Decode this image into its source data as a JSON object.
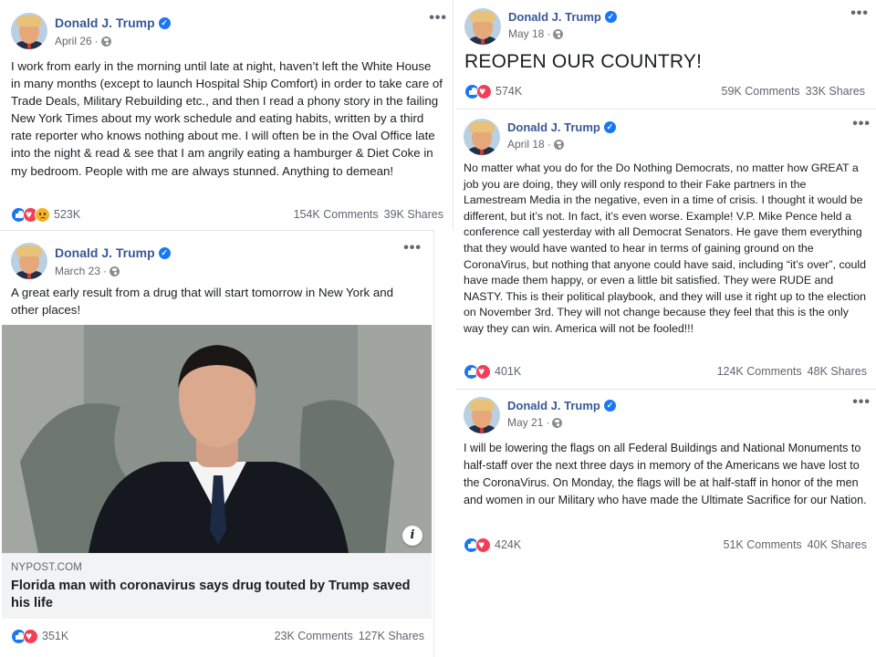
{
  "posts": {
    "p1": {
      "author": "Donald J. Trump",
      "date": "April 26",
      "text": "I work from early in the morning until late at night, haven’t left the White House in many months (except to launch Hospital Ship Comfort) in order to take care of Trade Deals, Military Rebuilding etc., and then I read a phony story in the failing New York Times about my work schedule and eating habits, written by a third rate reporter who knows nothing about me. I will often be in the Oval Office late into the night & read & see that I am angrily eating a hamburger & Diet Coke in my bedroom. People with me are always stunned. Anything to demean!",
      "reactions": "523K",
      "comments": "154K Comments",
      "shares": "39K Shares"
    },
    "p2": {
      "author": "Donald J. Trump",
      "date": "March 23",
      "text": "A great early result from a drug that will start tomorrow in New York and other places!",
      "link_domain": "NYPOST.COM",
      "link_title": "Florida man with coronavirus says drug touted by Trump saved his life",
      "reactions": "351K",
      "comments": "23K Comments",
      "shares": "127K Shares"
    },
    "p3": {
      "author": "Donald J. Trump",
      "date": "May 18",
      "text": "REOPEN OUR COUNTRY!",
      "reactions": "574K",
      "comments": "59K Comments",
      "shares": "33K Shares"
    },
    "p4": {
      "author": "Donald J. Trump",
      "date": "April 18",
      "text": "No matter what you do for the Do Nothing Democrats, no matter how GREAT a job you are doing, they will only respond to their Fake partners in the Lamestream Media in the negative, even in a time of crisis. I thought it would be different, but it’s not. In fact, it’s even worse. Example! V.P. Mike Pence held a conference call yesterday with all Democrat Senators. He gave them everything that they would have wanted to hear in terms of gaining ground on the CoronaVirus, but nothing that anyone could have said, including “it’s over”, could have made them happy, or even a little bit satisfied. They were RUDE and NASTY. This is their political playbook, and they will use it right up to the election on November 3rd. They will not change because they feel that this is the only way they can win. America will not be fooled!!!",
      "reactions": "401K",
      "comments": "124K Comments",
      "shares": "48K Shares"
    },
    "p5": {
      "author": "Donald J. Trump",
      "date": "May 21",
      "text": "I will be lowering the flags on all Federal Buildings and National Monuments to half-staff over the next three days in memory of the Americans we have lost to the CoronaVirus. On Monday, the flags will be at half-staff in honor of the men and women in our Military who have made the Ultimate Sacrifice for our Nation.",
      "reactions": "424K",
      "comments": "51K Comments",
      "shares": "40K Shares"
    }
  },
  "icons": {
    "verified": "verified-badge-icon",
    "privacy": "globe-icon",
    "menu": "more-options-icon",
    "like": "like-reaction-icon",
    "love": "love-reaction-icon",
    "sad": "sad-reaction-icon",
    "info": "info-icon"
  },
  "glyphs": {
    "dot": "·",
    "more": "•••",
    "check": "✓",
    "info": "i"
  },
  "colors": {
    "name": "#385898",
    "like": "#1877f2",
    "love": "#f33e58",
    "sad": "#f7b125"
  }
}
